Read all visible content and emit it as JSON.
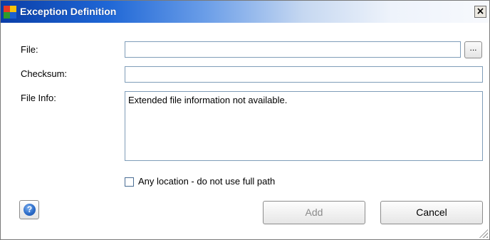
{
  "window": {
    "title": "Exception Definition",
    "close_glyph": "×",
    "icon": "avg-app-icon"
  },
  "form": {
    "file_label": "File:",
    "file_value": "",
    "browse_label": "...",
    "checksum_label": "Checksum:",
    "checksum_value": "",
    "fileinfo_label": "File Info:",
    "fileinfo_value": "Extended file information not available.",
    "any_location_label": "Any location - do not use full path",
    "any_location_checked": false
  },
  "buttons": {
    "help_icon": "help-icon",
    "help_glyph": "?",
    "add_label": "Add",
    "add_enabled": false,
    "cancel_label": "Cancel"
  },
  "colors": {
    "title_bar_start": "#0a3ea8",
    "title_bar_end": "#f7f9fd",
    "field_border": "#7f9db9",
    "disabled_text": "#8a8a8a"
  }
}
